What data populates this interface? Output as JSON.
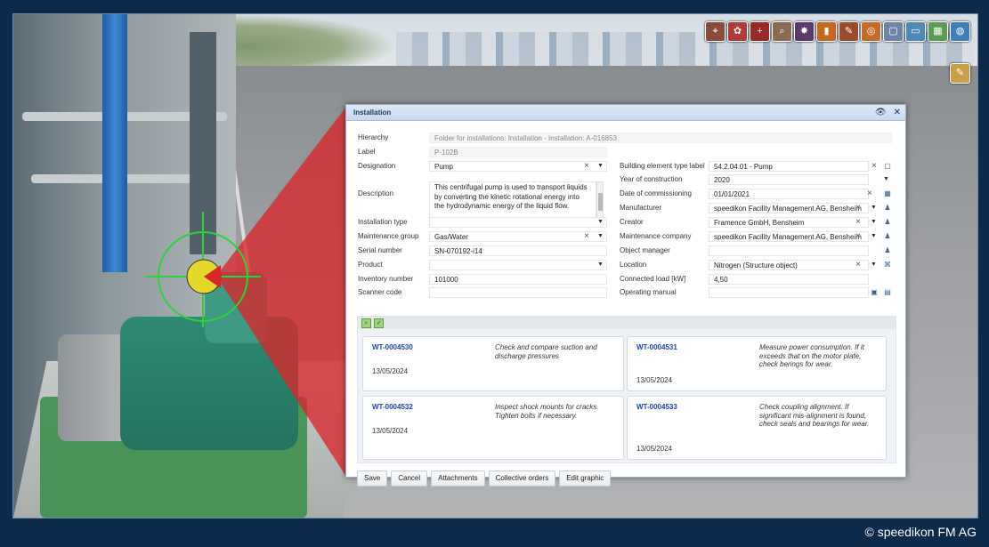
{
  "dialog": {
    "title": "Installation",
    "fields_left": [
      {
        "label": "Hierarchy",
        "value": ""
      },
      {
        "label": "Label",
        "value": "P-102B"
      },
      {
        "label": "Designation",
        "value": "Pump"
      },
      {
        "label": "Description",
        "value": "This centrifugal pump is used to transport liquids by converting the kinetic rotational energy into the hydrodynamic energy of the liquid flow."
      },
      {
        "label": "Installation type",
        "value": ""
      },
      {
        "label": "Maintenance group",
        "value": "Gas/Water"
      },
      {
        "label": "Serial number",
        "value": "SN-070192-i14"
      },
      {
        "label": "Product",
        "value": ""
      },
      {
        "label": "Inventory number",
        "value": "101000"
      },
      {
        "label": "Scanner code",
        "value": ""
      }
    ],
    "hierarchy_value": "Folder for installations: Installation - Installation: A-016853",
    "fields_right": [
      {
        "label": "Building element type label",
        "value": "54.2.04.01 - Pump"
      },
      {
        "label": "Year of construction",
        "value": "2020"
      },
      {
        "label": "Date of commissioning",
        "value": "01/01/2021"
      },
      {
        "label": "Manufacturer",
        "value": "speedikon Facility Management AG, Bensheim"
      },
      {
        "label": "Creator",
        "value": "Framence GmbH, Bensheim"
      },
      {
        "label": "Maintenance company",
        "value": "speedikon Facility Management AG, Bensheim"
      },
      {
        "label": "Object manager",
        "value": ""
      },
      {
        "label": "Location",
        "value": "Nitrogen (Structure object)"
      },
      {
        "label": "Connected load [kW]",
        "value": "4,50"
      },
      {
        "label": "Operating manual",
        "value": ""
      }
    ],
    "tasks": [
      {
        "id": "WT-0004530",
        "date": "13/05/2024",
        "text": "Check and compare suction and discharge pressures"
      },
      {
        "id": "WT-0004531",
        "date": "13/05/2024",
        "text": "Measure power consumption. If it exceeds that on the motor plate, check berings for wear."
      },
      {
        "id": "WT-0004532",
        "date": "13/05/2024",
        "text": "Inspect shock mounts for cracks. Tighten bolts if necessary."
      },
      {
        "id": "WT-0004533",
        "date": "13/05/2024",
        "text": "Check coupling alignment. If significant mis-alignment is found, check seals and bearings for wear."
      }
    ],
    "buttons": {
      "save": "Save",
      "cancel": "Cancel",
      "attachments": "Attachments",
      "collective": "Collective orders",
      "edit_graphic": "Edit graphic"
    }
  },
  "toolbar_icons": [
    "map-pin-icon",
    "flower-icon",
    "crosshair-icon",
    "magnifier-icon",
    "bomb-icon",
    "chart-icon",
    "sign-icon",
    "target-icon",
    "square-icon",
    "landscape-icon",
    "map-icon",
    "globe-icon"
  ],
  "toolbar_colors": [
    "#8a4b3a",
    "#b23a3a",
    "#9a2a2a",
    "#8a6a50",
    "#5a3a6a",
    "#c8681e",
    "#9c4a2e",
    "#c66b2a",
    "#6f85a8",
    "#4e8ab8",
    "#5b9b54",
    "#3e80b5"
  ],
  "copyright": "© speedikon FM AG"
}
